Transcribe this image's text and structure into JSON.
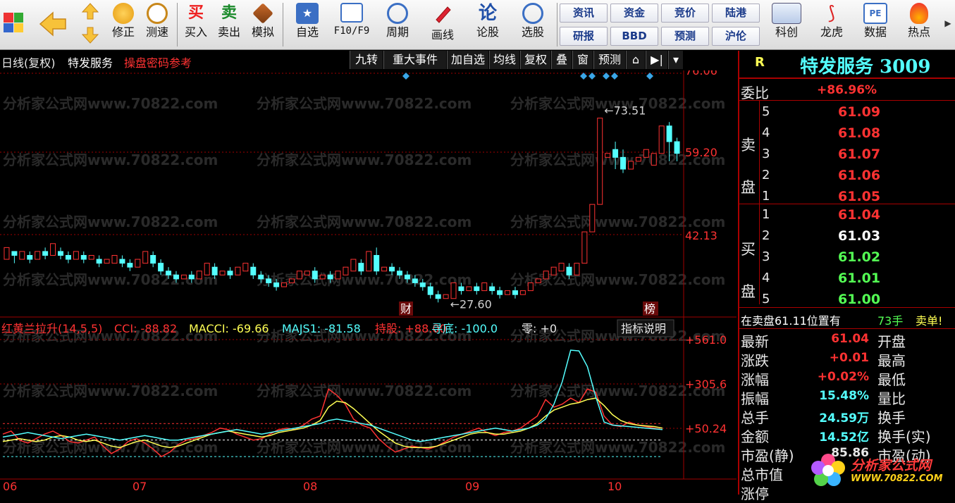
{
  "toolbar": {
    "items": [
      {
        "name": "layout-icon",
        "label": ""
      },
      {
        "name": "back-icon",
        "label": ""
      },
      {
        "name": "up-arrow-icon",
        "label": ""
      },
      {
        "name": "down-arrow-icon",
        "label": ""
      },
      {
        "name": "modify-icon",
        "label": "修正"
      },
      {
        "name": "speed-test-icon",
        "label": "测速"
      },
      {
        "name": "buy-icon",
        "label": "买入",
        "glyph": "买"
      },
      {
        "name": "sell-icon",
        "label": "卖出",
        "glyph": "卖"
      },
      {
        "name": "simulate-icon",
        "label": "模拟"
      },
      {
        "name": "watchlist-icon",
        "label": "自选"
      },
      {
        "name": "f10-icon",
        "label": "F10/F9"
      },
      {
        "name": "period-icon",
        "label": "周期"
      },
      {
        "name": "draw-line-icon",
        "label": "画线"
      },
      {
        "name": "forum-icon",
        "label": "论股",
        "glyph": "论"
      },
      {
        "name": "stock-pick-icon",
        "label": "选股"
      },
      {
        "name": "star-board-icon",
        "label": "科创"
      },
      {
        "name": "dragon-tiger-icon",
        "label": "龙虎"
      },
      {
        "name": "data-icon",
        "label": "数据",
        "glyph": "PE"
      },
      {
        "name": "hot-icon",
        "label": "热点"
      }
    ],
    "grid": [
      "资讯",
      "资金",
      "竞价",
      "陆港",
      "研报",
      "BBD",
      "预测",
      "沪伦"
    ]
  },
  "chart": {
    "header_mode": "日线(复权)",
    "stock_name": "特发服务",
    "promo": "操盘密码参考",
    "tabs": [
      "九转",
      "重大事件",
      "加自选",
      "均线",
      "复权",
      "叠",
      "窗",
      "预测",
      "⌂",
      "▶|",
      "▾"
    ],
    "price_axis": [
      "76.06",
      "59.20",
      "42.13"
    ],
    "high_marker": "73.51",
    "low_marker": "27.60",
    "tag_finance": "财",
    "tag_rank": "榜",
    "watermark": "分析家公式网www.70822.com",
    "indicator_line": {
      "name": "红黄兰拉升(14,5,5)",
      "cci_label": "CCI: -88.82",
      "macci_label": "MACCI: -69.66",
      "majs1_label": "MAJS1: -81.58",
      "hold_label": "持股: +88.00",
      "bottom_label": "寻底: -100.0",
      "zero_label": "零: +0",
      "explain": "指标说明"
    },
    "indicator_axis": [
      "+561.0",
      "+305.6",
      "+50.24"
    ],
    "x_axis": [
      "06",
      "07",
      "08",
      "09",
      "10"
    ]
  },
  "colors": {
    "up": "#ff3232",
    "down": "#54ffff",
    "cci": "#ff3232",
    "macci": "#ffff54",
    "majs1": "#54ffff",
    "grid": "#a00000"
  },
  "chart_data": {
    "type": "candlestick",
    "price_ylim": [
      20,
      80
    ],
    "indicator_ylim": [
      -300,
      640
    ],
    "candles": [
      [
        34,
        37,
        33,
        36
      ],
      [
        36,
        35,
        34,
        33
      ],
      [
        34,
        36,
        33,
        35
      ],
      [
        35,
        34,
        36,
        33
      ],
      [
        34,
        36,
        33,
        36
      ],
      [
        36,
        35,
        37,
        34
      ],
      [
        35,
        38,
        34,
        36
      ],
      [
        36,
        35,
        37,
        34
      ],
      [
        35,
        34,
        36,
        33
      ],
      [
        34,
        36,
        33,
        35
      ],
      [
        35,
        34,
        36,
        33
      ],
      [
        34,
        35,
        33,
        34
      ],
      [
        34,
        33,
        35,
        32
      ],
      [
        33,
        34,
        32,
        33
      ],
      [
        33,
        35,
        32,
        34
      ],
      [
        34,
        33,
        35,
        32
      ],
      [
        33,
        32,
        34,
        31
      ],
      [
        32,
        34,
        31,
        33
      ],
      [
        33,
        36,
        32,
        35
      ],
      [
        35,
        33,
        36,
        32
      ],
      [
        33,
        31,
        34,
        30
      ],
      [
        31,
        30,
        32,
        29
      ],
      [
        30,
        29,
        31,
        28
      ],
      [
        29,
        30,
        28,
        30
      ],
      [
        30,
        29,
        31,
        28
      ],
      [
        29,
        31,
        28,
        30
      ],
      [
        30,
        33,
        29,
        32
      ],
      [
        32,
        30,
        33,
        29
      ],
      [
        30,
        31,
        29,
        30
      ],
      [
        31,
        30,
        32,
        29
      ],
      [
        30,
        32,
        29,
        31
      ],
      [
        31,
        33,
        30,
        32
      ],
      [
        32,
        30,
        33,
        29
      ],
      [
        30,
        29,
        31,
        28
      ],
      [
        29,
        28,
        30,
        27
      ],
      [
        28,
        27,
        29,
        26
      ],
      [
        27,
        28,
        26,
        28
      ],
      [
        28,
        29,
        27,
        29
      ],
      [
        29,
        31,
        28,
        30
      ],
      [
        30,
        31,
        29,
        30
      ],
      [
        31,
        29,
        32,
        28
      ],
      [
        29,
        30,
        28,
        29
      ],
      [
        30,
        29,
        31,
        28
      ],
      [
        29,
        31,
        28,
        30
      ],
      [
        30,
        32,
        29,
        31
      ],
      [
        31,
        34,
        30,
        33
      ],
      [
        33,
        31,
        34,
        30
      ],
      [
        31,
        36,
        30,
        35
      ],
      [
        35,
        31,
        37,
        30
      ],
      [
        31,
        32,
        30,
        31
      ],
      [
        32,
        31,
        33,
        30
      ],
      [
        31,
        30,
        32,
        29
      ],
      [
        30,
        29,
        31,
        28
      ],
      [
        29,
        28,
        30,
        27
      ],
      [
        28,
        27,
        29,
        26
      ],
      [
        27,
        25,
        28,
        24
      ],
      [
        25,
        24,
        26,
        23
      ],
      [
        24,
        25,
        23,
        24
      ],
      [
        24,
        28,
        23,
        27
      ],
      [
        27,
        26,
        28,
        25
      ],
      [
        26,
        27,
        25,
        26
      ],
      [
        27,
        26,
        28,
        25
      ],
      [
        26,
        28,
        25,
        27
      ],
      [
        27,
        26,
        28,
        25
      ],
      [
        26,
        25,
        27,
        24
      ],
      [
        25,
        26,
        24,
        25
      ],
      [
        26,
        25,
        27,
        24
      ],
      [
        25,
        26,
        24,
        26
      ],
      [
        26,
        28,
        25,
        28
      ],
      [
        28,
        29,
        27,
        29
      ],
      [
        29,
        31,
        28,
        30
      ],
      [
        30,
        32,
        29,
        31
      ],
      [
        31,
        33,
        30,
        32
      ],
      [
        32,
        30,
        33,
        29
      ],
      [
        30,
        33,
        29,
        33
      ],
      [
        33,
        41,
        32,
        40
      ],
      [
        41,
        48,
        40,
        47
      ],
      [
        48,
        70,
        46,
        71
      ],
      [
        60,
        61,
        58,
        62
      ],
      [
        62,
        60,
        64,
        57
      ],
      [
        60,
        57,
        62,
        56
      ],
      [
        57,
        59,
        55,
        59
      ],
      [
        59,
        60,
        57,
        61
      ],
      [
        60,
        62,
        58,
        63
      ],
      [
        58,
        61,
        56,
        62
      ],
      [
        61,
        68,
        60,
        69
      ],
      [
        68,
        64,
        69,
        59
      ],
      [
        64,
        61,
        65,
        59
      ]
    ],
    "series": [
      {
        "name": "CCI",
        "values": [
          0,
          20,
          -40,
          -60,
          -30,
          0,
          20,
          -10,
          -50,
          -60,
          -40,
          -20,
          -80,
          -130,
          -100,
          -50,
          -30,
          -60,
          -100,
          -150,
          -120,
          -70,
          -40,
          -30,
          -10,
          10,
          40,
          30,
          0,
          -20,
          -40,
          -30,
          0,
          30,
          40,
          30,
          60,
          100,
          120,
          300,
          260,
          200,
          100,
          60,
          40,
          -30,
          -80,
          -120,
          -100,
          -80,
          -90,
          -100,
          -80,
          -50,
          -20,
          0,
          20,
          40,
          10,
          -10,
          10,
          20,
          40,
          80,
          120,
          230,
          180,
          200,
          240,
          210,
          300,
          280,
          120,
          60,
          50,
          80,
          60,
          50,
          40,
          30
        ]
      },
      {
        "name": "MACCI",
        "values": [
          -50,
          -40,
          -30,
          -40,
          -50,
          -40,
          -20,
          -10,
          -20,
          -40,
          -50,
          -40,
          -60,
          -80,
          -90,
          -70,
          -50,
          -40,
          -60,
          -80,
          -90,
          -80,
          -60,
          -40,
          -20,
          0,
          10,
          20,
          10,
          0,
          -10,
          -20,
          -10,
          10,
          20,
          30,
          40,
          60,
          90,
          180,
          220,
          210,
          170,
          120,
          70,
          20,
          -20,
          -60,
          -80,
          -90,
          -90,
          -90,
          -80,
          -60,
          -40,
          -20,
          0,
          10,
          10,
          0,
          0,
          10,
          20,
          40,
          70,
          120,
          160,
          180,
          200,
          210,
          230,
          240,
          190,
          130,
          90,
          70,
          60,
          55,
          50,
          40
        ]
      },
      {
        "name": "MAJS1",
        "values": [
          -20,
          -10,
          0,
          10,
          0,
          -10,
          -20,
          -30,
          -20,
          -10,
          0,
          -10,
          -20,
          -30,
          -40,
          -30,
          -20,
          -10,
          -20,
          -30,
          -40,
          -40,
          -30,
          -20,
          -10,
          0,
          10,
          20,
          30,
          20,
          10,
          0,
          10,
          20,
          30,
          40,
          50,
          60,
          70,
          90,
          100,
          90,
          80,
          70,
          60,
          40,
          20,
          0,
          -20,
          -40,
          -50,
          -40,
          -30,
          -20,
          -10,
          0,
          10,
          20,
          30,
          40,
          30,
          20,
          30,
          40,
          60,
          100,
          200,
          350,
          560,
          555,
          450,
          250,
          80,
          60,
          55,
          50,
          45,
          40,
          35,
          30
        ]
      }
    ],
    "reference_lines": [
      70,
      -40,
      -150
    ],
    "x_ticks": [
      "06",
      "07",
      "08",
      "09",
      "10"
    ]
  },
  "right_panel": {
    "code_prefix": "R",
    "title": "特发服务 3009",
    "committee_label": "委比",
    "committee_value": "+86.96%",
    "sell_label_1": "卖",
    "sell_label_2": "盘",
    "buy_label_1": "买",
    "buy_label_2": "盘",
    "sells": [
      {
        "lvl": "5",
        "price": "61.09"
      },
      {
        "lvl": "4",
        "price": "61.08"
      },
      {
        "lvl": "3",
        "price": "61.07"
      },
      {
        "lvl": "2",
        "price": "61.06"
      },
      {
        "lvl": "1",
        "price": "61.05"
      }
    ],
    "buys": [
      {
        "lvl": "1",
        "price": "61.04",
        "color": "#ff3232"
      },
      {
        "lvl": "2",
        "price": "61.03",
        "color": "#ffffff"
      },
      {
        "lvl": "3",
        "price": "61.02",
        "color": "#54ff54"
      },
      {
        "lvl": "4",
        "price": "61.01",
        "color": "#54ff54"
      },
      {
        "lvl": "5",
        "price": "61.00",
        "color": "#54ff54"
      }
    ],
    "notice_text": "在卖盘61.11位置有",
    "notice_qty": "73手",
    "notice_tag": "卖单!",
    "stats": [
      {
        "k": "最新",
        "v": "61.04",
        "color": "#ff3232",
        "k2": "开盘"
      },
      {
        "k": "涨跌",
        "v": "+0.01",
        "color": "#ff3232",
        "k2": "最高"
      },
      {
        "k": "涨幅",
        "v": "+0.02%",
        "color": "#ff3232",
        "k2": "最低"
      },
      {
        "k": "振幅",
        "v": "15.48%",
        "color": "#54ffff",
        "k2": "量比"
      },
      {
        "k": "总手",
        "v": "24.59万",
        "color": "#54ffff",
        "k2": "换手"
      },
      {
        "k": "金额",
        "v": "14.52亿",
        "color": "#54ffff",
        "k2": "换手(实)"
      },
      {
        "k": "市盈(静)",
        "v": "85.86",
        "color": "#e8e8e8",
        "k2": "市盈(动)"
      },
      {
        "k": "总市值",
        "v": "",
        "color": "#e8e8e8",
        "k2": ""
      },
      {
        "k": "涨停",
        "v": "",
        "color": "#e8e8e8",
        "k2": ""
      }
    ],
    "logo_text": "分析家公式网",
    "logo_url": "WWW.70822.COM"
  }
}
